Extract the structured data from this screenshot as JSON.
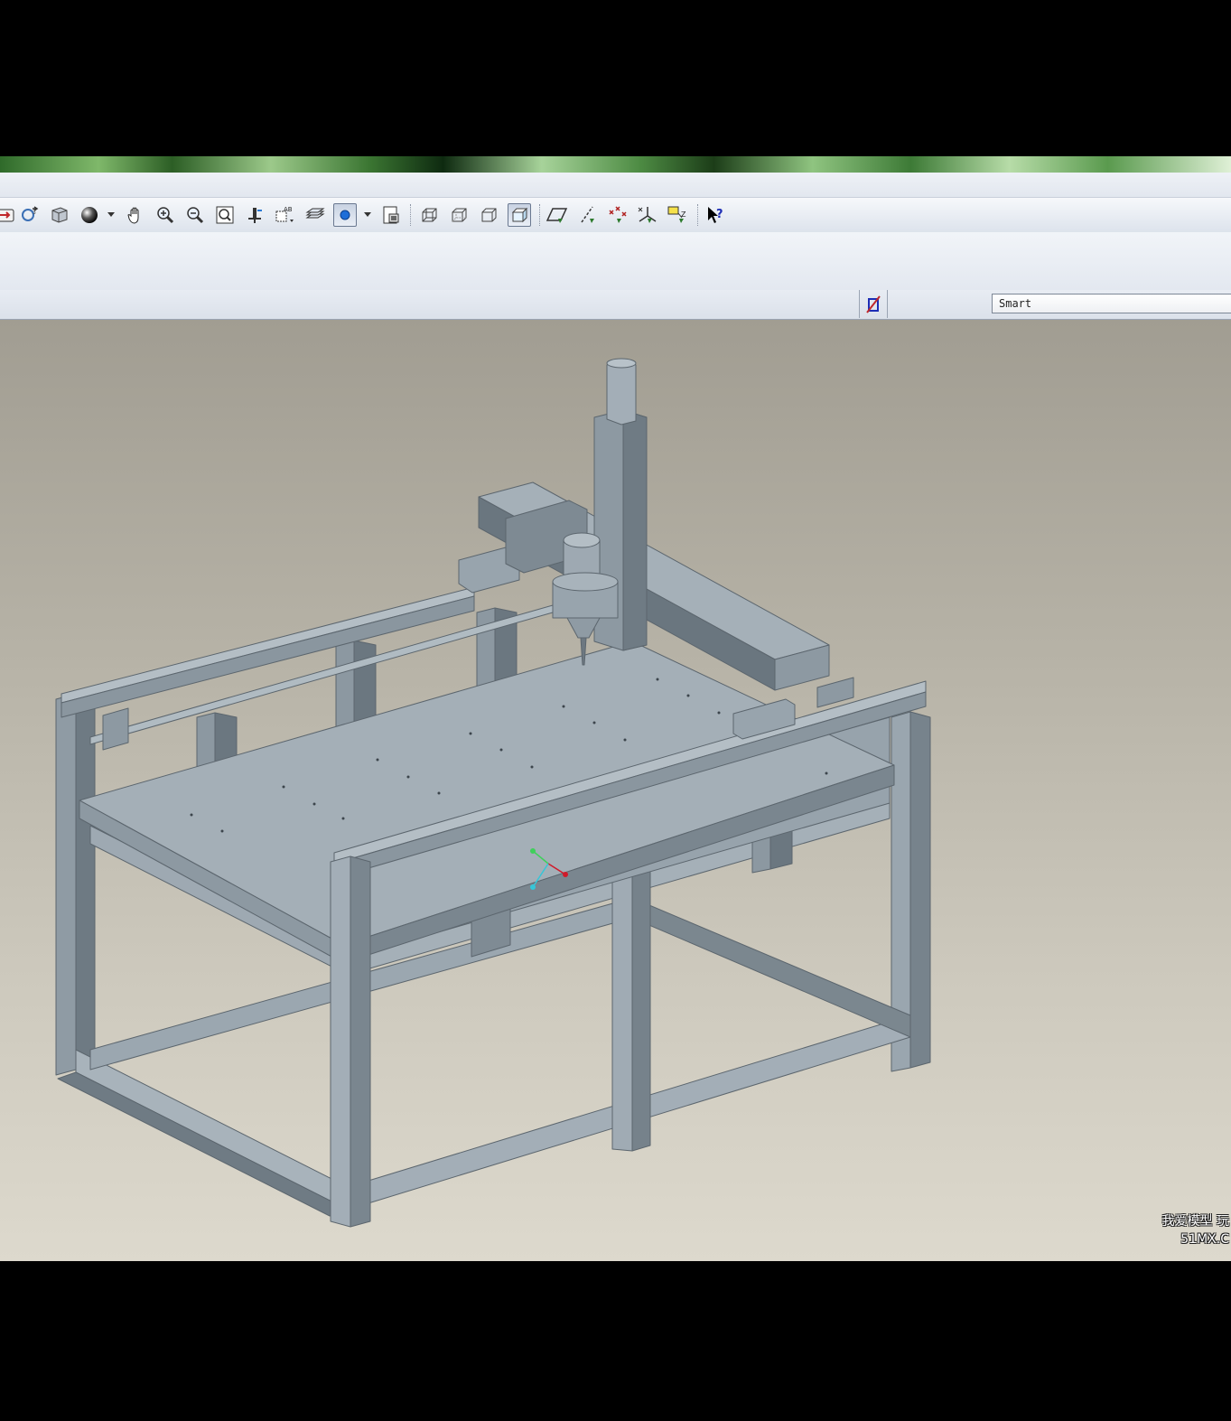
{
  "toolbar": {
    "buttons": [
      {
        "icon": "regenerate-icon"
      },
      {
        "icon": "reorient-icon"
      },
      {
        "icon": "saved-views-icon"
      },
      {
        "icon": "display-style-icon"
      },
      {
        "icon": "pan-icon"
      },
      {
        "icon": "zoom-in-icon"
      },
      {
        "icon": "zoom-out-icon"
      },
      {
        "icon": "refit-icon"
      },
      {
        "icon": "spin-center-icon"
      },
      {
        "icon": "annotation-icon"
      },
      {
        "icon": "layers-icon"
      },
      {
        "icon": "view-mode-icon"
      },
      {
        "icon": "view-manager-icon"
      },
      {
        "icon": "wireframe-icon"
      },
      {
        "icon": "hidden-line-icon"
      },
      {
        "icon": "no-hidden-icon"
      },
      {
        "icon": "shading-icon"
      },
      {
        "icon": "datum-planes-icon"
      },
      {
        "icon": "datum-axes-icon"
      },
      {
        "icon": "datum-points-icon"
      },
      {
        "icon": "coordinate-systems-icon"
      },
      {
        "icon": "annotations-display-icon"
      },
      {
        "icon": "context-help-icon"
      }
    ]
  },
  "filter": {
    "icon": "selection-filter-icon",
    "value": "Smart"
  },
  "viewport": {
    "model": "cnc-router-assembly",
    "watermark_line1": "我爱模型 玩",
    "watermark_line2": "51MX.C"
  },
  "colors": {
    "model_face_light": "#a6b1ba",
    "model_face_mid": "#8a969f",
    "model_face_dark": "#5f6a73"
  }
}
